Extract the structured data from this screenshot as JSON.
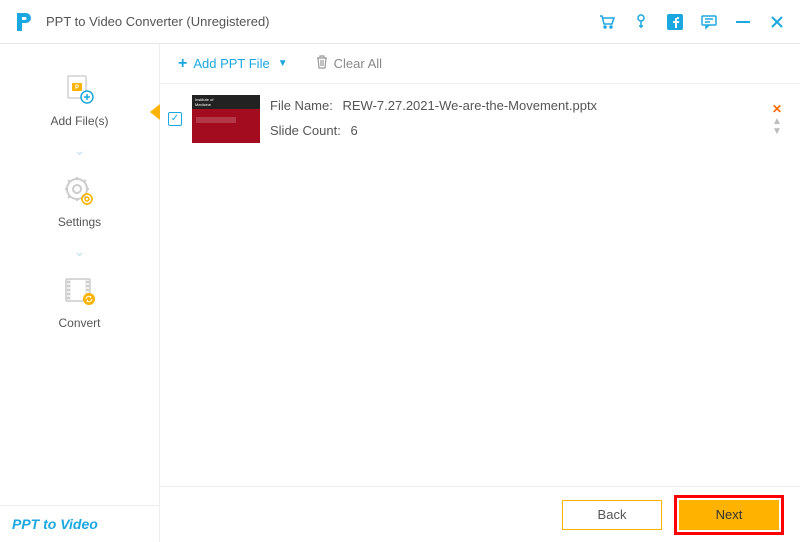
{
  "titlebar": {
    "title": "PPT to Video Converter (Unregistered)"
  },
  "sidebar": {
    "items": [
      {
        "label": "Add File(s)"
      },
      {
        "label": "Settings"
      },
      {
        "label": "Convert"
      }
    ],
    "brand": "PPT to Video"
  },
  "toolbar": {
    "add_label": "Add PPT File",
    "clear_label": "Clear All"
  },
  "file": {
    "name_label": "File Name:",
    "name_value": "REW-7.27.2021-We-are-the-Movement.pptx",
    "slide_label": "Slide Count:",
    "slide_value": "6",
    "checked": true
  },
  "footer": {
    "back": "Back",
    "next": "Next"
  }
}
